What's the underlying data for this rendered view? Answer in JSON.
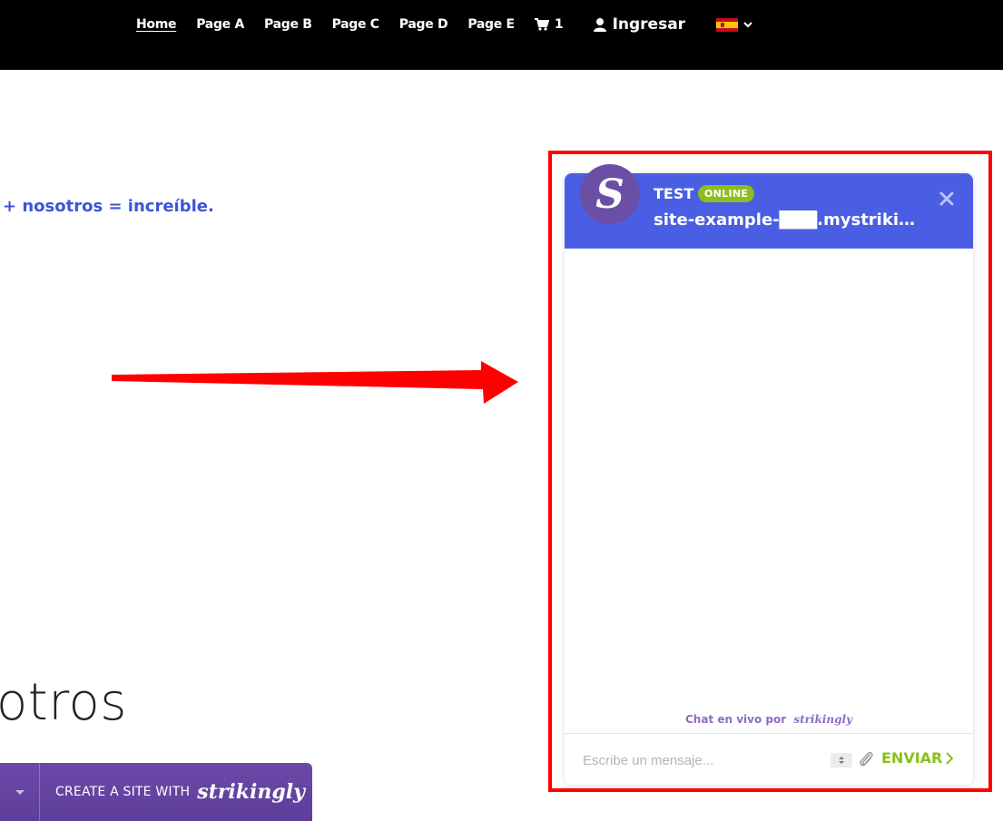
{
  "nav": {
    "links": [
      "Home",
      "Page A",
      "Page B",
      "Page C",
      "Page D",
      "Page E"
    ],
    "cart_count": "1",
    "login_label": "Ingresar",
    "language": "es"
  },
  "page": {
    "tagline": "+ nosotros = increíble.",
    "heading": "otros"
  },
  "strikingly_bar": {
    "label": "CREATE A SITE WITH",
    "brand": "strikingly"
  },
  "chat": {
    "name": "TEST",
    "status": "ONLINE",
    "site": "site-example-███.mystrikin...",
    "avatar_letter": "S",
    "powered_by_label": "Chat en vivo por",
    "powered_by_brand": "strikingly",
    "input_placeholder": "Escribe un mensaje...",
    "send_label": "ENVIAR"
  },
  "colors": {
    "accent": "#4a5ee3",
    "online": "#8bbf1b",
    "highlight": "#ff0000",
    "brand_purple": "#6b49a8"
  }
}
